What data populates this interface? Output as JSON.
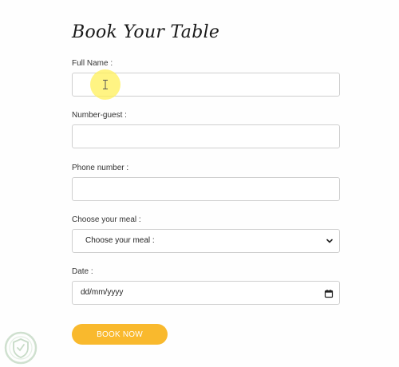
{
  "form": {
    "title": "Book Your Table",
    "full_name": {
      "label": "Full Name :",
      "value": ""
    },
    "number_guest": {
      "label": "Number-guest :",
      "value": ""
    },
    "phone": {
      "label": "Phone number :",
      "value": ""
    },
    "meal": {
      "label": "Choose your meal :",
      "selected": "Choose your meal :"
    },
    "date": {
      "label": "Date :",
      "placeholder": "dd/mm/yyyy"
    },
    "submit_label": "BOOK NOW"
  },
  "icons": {
    "select_arrow": "chevron-down-icon",
    "date_picker": "calendar-icon",
    "text_cursor": "text-cursor-icon",
    "watermark": "shield-logo"
  },
  "colors": {
    "accent": "#f9b92d",
    "field_border": "#cfcfcf",
    "cursor_highlight": "#fff05a"
  }
}
